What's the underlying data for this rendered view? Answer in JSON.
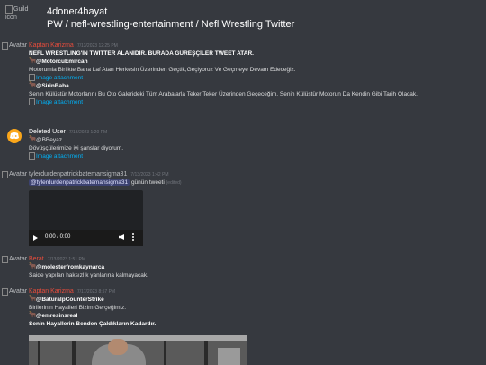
{
  "header": {
    "guild_icon_alt": "Guild icon",
    "guild_name": "4doner4hayat",
    "channel_path": "PW / nefl-wrestling-entertainment / Nefl Wrestling Twitter"
  },
  "common": {
    "avatar_alt": "Avatar",
    "attachment_text": "Image attachment"
  },
  "messages": [
    {
      "author": "Kaptan Karizma",
      "timestamp": "7/13/2023 12:25 PM",
      "lines": [
        "NEFL WRESTLING'IN TWITTER ALANIDIR. BURADA GÜREŞÇİLER TWEET ATAR.",
        "@MotorcuEmircan",
        "Motorumla Birlikte Bana Laf Atan Herkesin Üzerinden Geçtik,Geçiyoruz Ve Geçmeye Devam Edeceğiz.",
        "@SirinBaba",
        "Senin Külüstür Motorlarını Bu Oto Galerideki Tüm Arabalarla Teker Teker Üzerinden Geçeceğim. Senin Külüstür Motorun Da Kendin Gibi Tarih Olacak."
      ]
    },
    {
      "author": "Deleted User",
      "timestamp": "7/13/2023 1:20 PM",
      "lines": [
        "@BBeyaz",
        "Dövüşçülerimize iyi şanslar diyorum."
      ]
    },
    {
      "author": "tylerdurdenpatrickbatemansigma31",
      "timestamp": "7/13/2023 1:42 PM",
      "mention": "@tylerdurdenpatrickbatemansigma31",
      "text_after": " günün tweeti",
      "edited": "(edited)",
      "video_time": "0:00 / 0:00"
    },
    {
      "author": "Berat",
      "timestamp": "7/13/2023 1:51 PM",
      "lines": [
        "@molesterfromkaynarca",
        "Saide yapılan haksızlık yanlarına kalmayacak."
      ]
    },
    {
      "author": "Kaptan Karizma",
      "timestamp": "7/17/2023 8:57 PM",
      "lines": [
        "@BaturalpCounterStrike",
        "Birilerinin Hayalleri Bizim Gerçeğimiz.",
        "@emresinsreal",
        "Senin Hayallerin Benden Çaldıkların Kadardır."
      ]
    }
  ],
  "colors": {
    "background": "#36393f",
    "link": "#00b0f4",
    "author_red": "#e74c3c",
    "discord_avatar": "#faa61a"
  }
}
